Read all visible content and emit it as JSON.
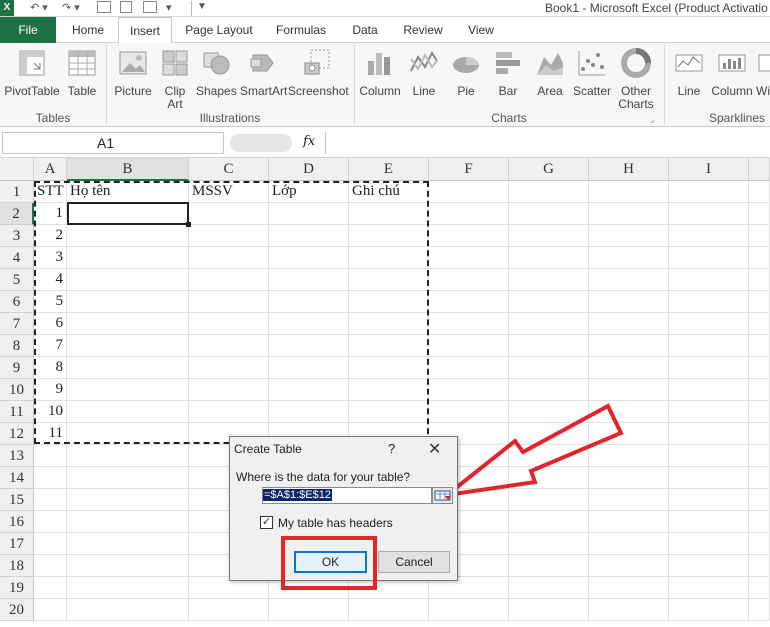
{
  "window": {
    "title": "Book1 - Microsoft Excel (Product Activatio"
  },
  "qat": {
    "logo": "X",
    "undo": "↶ ▾",
    "redo": "↷ ▾",
    "more": "▾"
  },
  "tabs": [
    {
      "label": "File"
    },
    {
      "label": "Home"
    },
    {
      "label": "Insert"
    },
    {
      "label": "Page Layout"
    },
    {
      "label": "Formulas"
    },
    {
      "label": "Data"
    },
    {
      "label": "Review"
    },
    {
      "label": "View"
    }
  ],
  "ribbon": {
    "buttons": [
      {
        "label": "PivotTable",
        "icon": "pivottable-icon"
      },
      {
        "label": "Table",
        "icon": "table-icon"
      },
      {
        "label": "Picture",
        "icon": "picture-icon"
      },
      {
        "label": "Clip Art",
        "icon": "clipart-icon"
      },
      {
        "label": "Shapes",
        "icon": "shapes-icon"
      },
      {
        "label": "SmartArt",
        "icon": "smartart-icon"
      },
      {
        "label": "Screenshot",
        "icon": "screenshot-icon"
      },
      {
        "label": "Column",
        "icon": "column-chart-icon"
      },
      {
        "label": "Line",
        "icon": "line-chart-icon"
      },
      {
        "label": "Pie",
        "icon": "pie-chart-icon"
      },
      {
        "label": "Bar",
        "icon": "bar-chart-icon"
      },
      {
        "label": "Area",
        "icon": "area-chart-icon"
      },
      {
        "label": "Scatter",
        "icon": "scatter-chart-icon"
      },
      {
        "label": "Other Charts",
        "icon": "other-charts-icon"
      },
      {
        "label": "Line",
        "icon": "sparkline-line-icon"
      },
      {
        "label": "Column",
        "icon": "sparkline-column-icon"
      },
      {
        "label": "Win",
        "icon": "sparkline-winloss-icon"
      }
    ],
    "groups": {
      "tables": "Tables",
      "illustrations": "Illustrations",
      "charts": "Charts",
      "sparklines": "Sparklines"
    }
  },
  "formula_bar": {
    "name_box": "A1",
    "fx": "fx",
    "value": ""
  },
  "columns": [
    "A",
    "B",
    "C",
    "D",
    "E",
    "F",
    "G",
    "H",
    "I"
  ],
  "rows": [
    "1",
    "2",
    "3",
    "4",
    "5",
    "6",
    "7",
    "8",
    "9",
    "10",
    "11",
    "12",
    "13",
    "14",
    "15",
    "16",
    "17",
    "18",
    "19",
    "20"
  ],
  "headers_row": {
    "A": "STT",
    "B": "Họ tên",
    "C": "MSSV",
    "D": "Lớp",
    "E": "Ghi chú"
  },
  "stt": [
    "1",
    "2",
    "3",
    "4",
    "5",
    "6",
    "7",
    "8",
    "9",
    "10",
    "11"
  ],
  "dialog": {
    "title": "Create Table",
    "help": "?",
    "close": "✕",
    "question": "Where is the data for your table?",
    "range": "=$A$1:$E$12",
    "checkbox_label": "My table has headers",
    "checkbox_checked": "✓",
    "ok": "OK",
    "cancel": "Cancel"
  },
  "colors": {
    "excel_green": "#1e7145",
    "highlight_red": "#e3242b"
  }
}
